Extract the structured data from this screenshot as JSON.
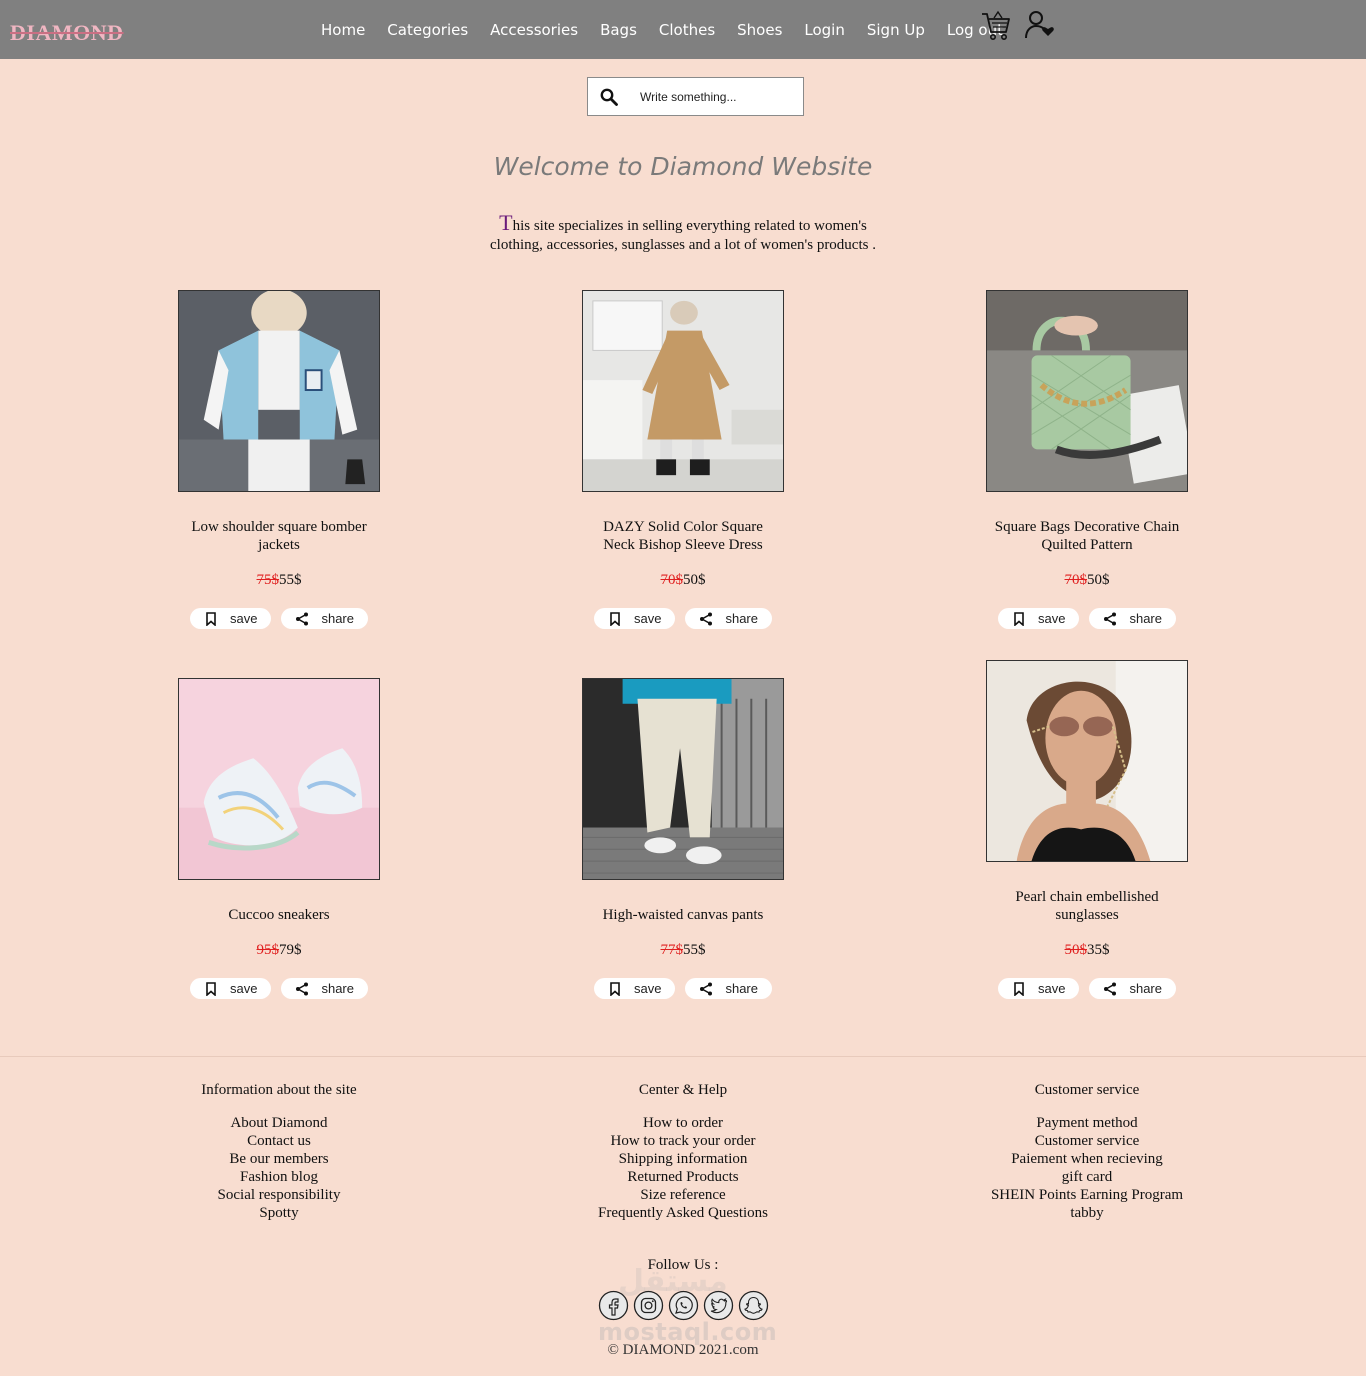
{
  "nav": {
    "logo": "DIAMOND",
    "links": [
      "Home",
      "Categories",
      "Accessories",
      "Bags",
      "Clothes",
      "Shoes",
      "Login",
      "Sign Up",
      "Log out"
    ],
    "cart_icon": "shopping-cart-icon",
    "user_icon": "user-heart-icon"
  },
  "search": {
    "placeholder": "Write something...",
    "icon": "search-icon"
  },
  "hero": {
    "title": "Welcome to Diamond Website",
    "intro_first_letter": "T",
    "intro_rest": "his site specializes in selling everything related to women's clothing, accessories, sunglasses and a lot of women's products ."
  },
  "products": [
    {
      "name": "Low shoulder square bomber jackets",
      "old_price": "75$",
      "new_price": "55$",
      "save": "save",
      "share": "share"
    },
    {
      "name": "DAZY Solid Color Square Neck Bishop Sleeve Dress",
      "old_price": "70$",
      "new_price": "50$",
      "save": "save",
      "share": "share"
    },
    {
      "name": "Square Bags Decorative Chain Quilted Pattern",
      "old_price": "70$",
      "new_price": "50$",
      "save": "save",
      "share": "share"
    },
    {
      "name": "Cuccoo sneakers",
      "old_price": "95$",
      "new_price": "79$",
      "save": "save",
      "share": "share"
    },
    {
      "name": "High-waisted canvas pants",
      "old_price": "77$",
      "new_price": "55$",
      "save": "save",
      "share": "share"
    },
    {
      "name": "Pearl chain embellished sunglasses",
      "old_price": "50$",
      "new_price": "35$",
      "save": "save",
      "share": "share"
    }
  ],
  "footer": {
    "columns": [
      {
        "title": "Information about the site",
        "links": [
          "About Diamond",
          "Contact us",
          "Be our members",
          "Fashion blog",
          "Social responsibility",
          "Spotty"
        ]
      },
      {
        "title": "Center & Help",
        "links": [
          "How to order",
          "How to track your order",
          "Shipping information",
          "Returned Products",
          "Size reference",
          "Frequently Asked Questions"
        ]
      },
      {
        "title": "Customer service",
        "links": [
          "Payment method",
          "Customer service",
          "Paiement when recieving",
          "gift card",
          "SHEIN Points Earning Program",
          "tabby"
        ]
      }
    ],
    "follow_label": "Follow Us :",
    "socials": [
      "facebook-icon",
      "instagram-icon",
      "whatsapp-icon",
      "twitter-icon",
      "snapchat-icon"
    ],
    "watermark": "mostaql.com",
    "watermark_ar": "مستقل",
    "copyright": "© DIAMOND 2021.com"
  },
  "colors": {
    "navbar": "#808080",
    "background": "#f8ddd0",
    "old_price": "#e02020",
    "logo": "#f0b6c2"
  }
}
